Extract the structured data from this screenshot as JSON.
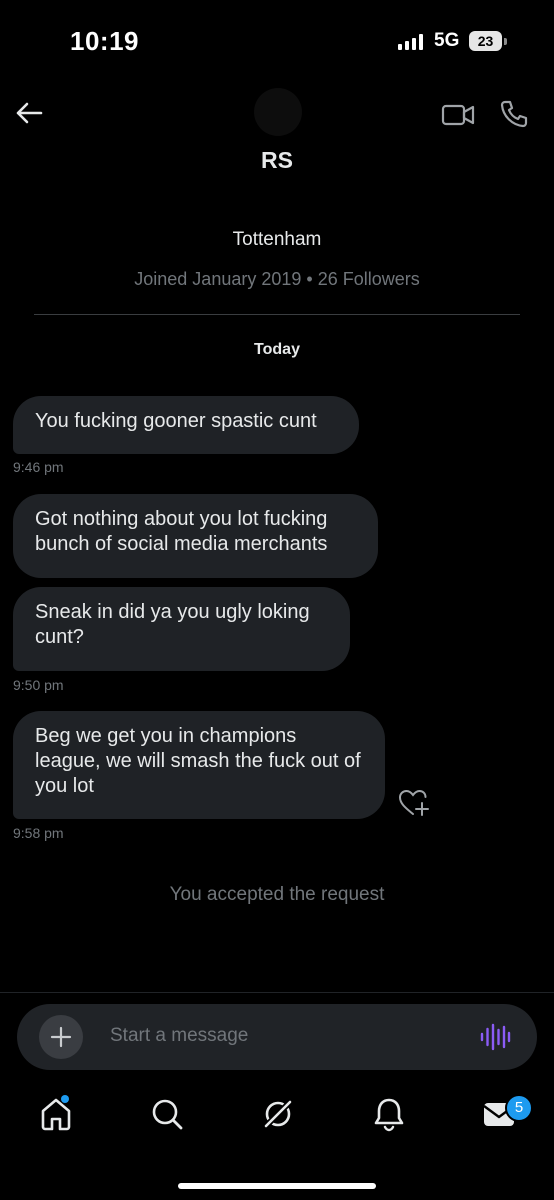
{
  "status_bar": {
    "time": "10:19",
    "network": "5G",
    "battery": "23"
  },
  "header": {
    "contact_name": "RS",
    "back_icon": "arrow-left-icon",
    "video_icon": "video-camera-icon",
    "phone_icon": "phone-icon"
  },
  "profile": {
    "bio": "Tottenham",
    "meta": "Joined January 2019 • 26 Followers"
  },
  "conversation": {
    "day_label": "Today",
    "messages": [
      {
        "text": "You fucking gooner spastic cunt"
      },
      {
        "text": "Got nothing about you lot fucking bunch of social media merchants"
      },
      {
        "text": "Sneak in did ya you ugly loking cunt?"
      },
      {
        "text": "Beg we get you in champions league, we will smash the fuck out of you lot"
      }
    ],
    "timestamps": [
      "9:46 pm",
      "9:50 pm",
      "9:58 pm"
    ],
    "system_note": "You accepted the request"
  },
  "composer": {
    "placeholder": "Start a message"
  },
  "nav": {
    "items": [
      "home-icon",
      "search-icon",
      "grok-icon",
      "notifications-icon",
      "messages-icon"
    ],
    "messages_badge": "5"
  },
  "colors": {
    "background": "#000000",
    "bubble": "#1f2226",
    "muted_text": "#71767b",
    "accent": "#1d9bf0",
    "voice_accent": "#8b5cf6"
  }
}
